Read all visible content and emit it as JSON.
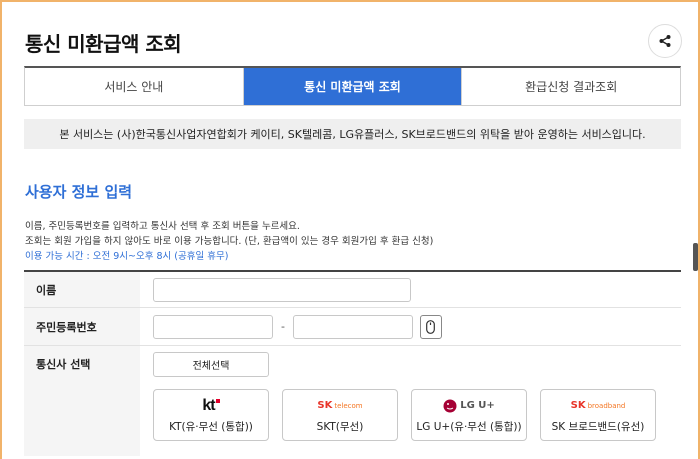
{
  "page": {
    "title": "통신 미환급액 조회"
  },
  "tabs": [
    {
      "label": "서비스 안내",
      "active": false
    },
    {
      "label": "통신 미환급액 조회",
      "active": true
    },
    {
      "label": "환급신청 결과조회",
      "active": false
    }
  ],
  "notice": "본 서비스는 (사)한국통신사업자연합회가 케이티, SK텔레콤, LG유플러스, SK브로드밴드의 위탁을 받아 운영하는 서비스입니다.",
  "section": {
    "title": "사용자 정보 입력",
    "desc_line1": "이름, 주민등록번호를 입력하고 통신사 선택 후 조회 버튼을 누르세요.",
    "desc_line2": "조회는 회원 가입을 하지 않아도 바로 이용 가능합니다. (단, 환급액이 있는 경우 회원가입 후 환급 신청)",
    "desc_hours": "이용 가능 시간 : 오전 9시~오후 8시 (공휴일 휴무)"
  },
  "form": {
    "name_label": "이름",
    "name_value": "",
    "rrn_label": "주민등록번호",
    "rrn_first_value": "",
    "rrn_dash": "-",
    "rrn_second_value": "",
    "carrier_label": "통신사 선택",
    "select_all_label": "전체선택"
  },
  "carriers": [
    {
      "logo_text": "kt",
      "name": "KT(유·무선 (통합))",
      "icon": "kt-logo"
    },
    {
      "logo_text": "SK telecom",
      "name": "SKT(무선)",
      "icon": "sk-telecom-logo"
    },
    {
      "logo_text": "LG U+",
      "name": "LG U+(유·무선 (통합))",
      "icon": "lg-uplus-logo"
    },
    {
      "logo_text": "SK broadband",
      "name": "SK 브로드밴드(유선)",
      "icon": "sk-broadband-logo"
    }
  ],
  "colors": {
    "accent": "#2f6fd6",
    "frame": "#f1b36a",
    "kt_red": "#e4002b",
    "sk_red": "#e8352a",
    "sk_orange": "#f47725",
    "lg_magenta": "#a50034"
  }
}
